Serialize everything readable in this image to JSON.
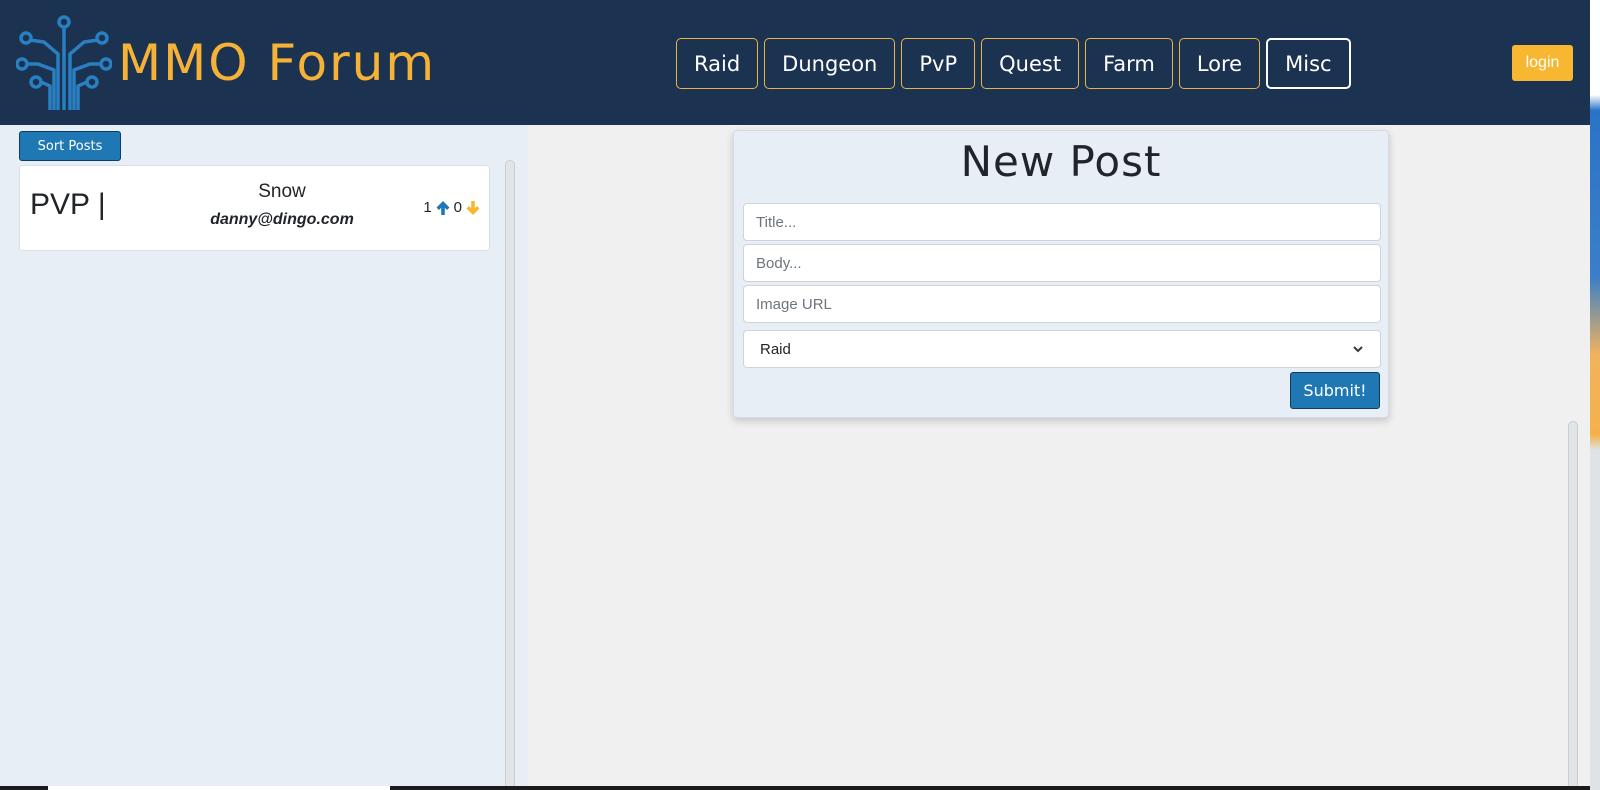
{
  "header": {
    "brand": "MMO Forum",
    "logo_icon": "circuit-tree-icon",
    "nav": [
      {
        "label": "Raid"
      },
      {
        "label": "Dungeon"
      },
      {
        "label": "PvP"
      },
      {
        "label": "Quest"
      },
      {
        "label": "Farm"
      },
      {
        "label": "Lore"
      },
      {
        "label": "Misc",
        "active": true
      }
    ],
    "login_label": "login"
  },
  "sidebar": {
    "sort_label": "Sort Posts",
    "posts": [
      {
        "category": "PVP |",
        "title": "Snow",
        "author": "danny@dingo.com",
        "upvotes": "1",
        "downvotes": "0"
      }
    ]
  },
  "new_post": {
    "heading": "New Post",
    "title_placeholder": "Title...",
    "body_placeholder": "Body...",
    "image_placeholder": "Image URL",
    "category_selected": "Raid",
    "submit_label": "Submit!"
  },
  "colors": {
    "header_bg": "#1b3250",
    "brand": "#f6b137",
    "nav_border": "#e9b348",
    "login_bg": "#f7b731",
    "primary_button": "#1f78b4",
    "upvote": "#1f78b4",
    "downvote": "#f7b731"
  }
}
